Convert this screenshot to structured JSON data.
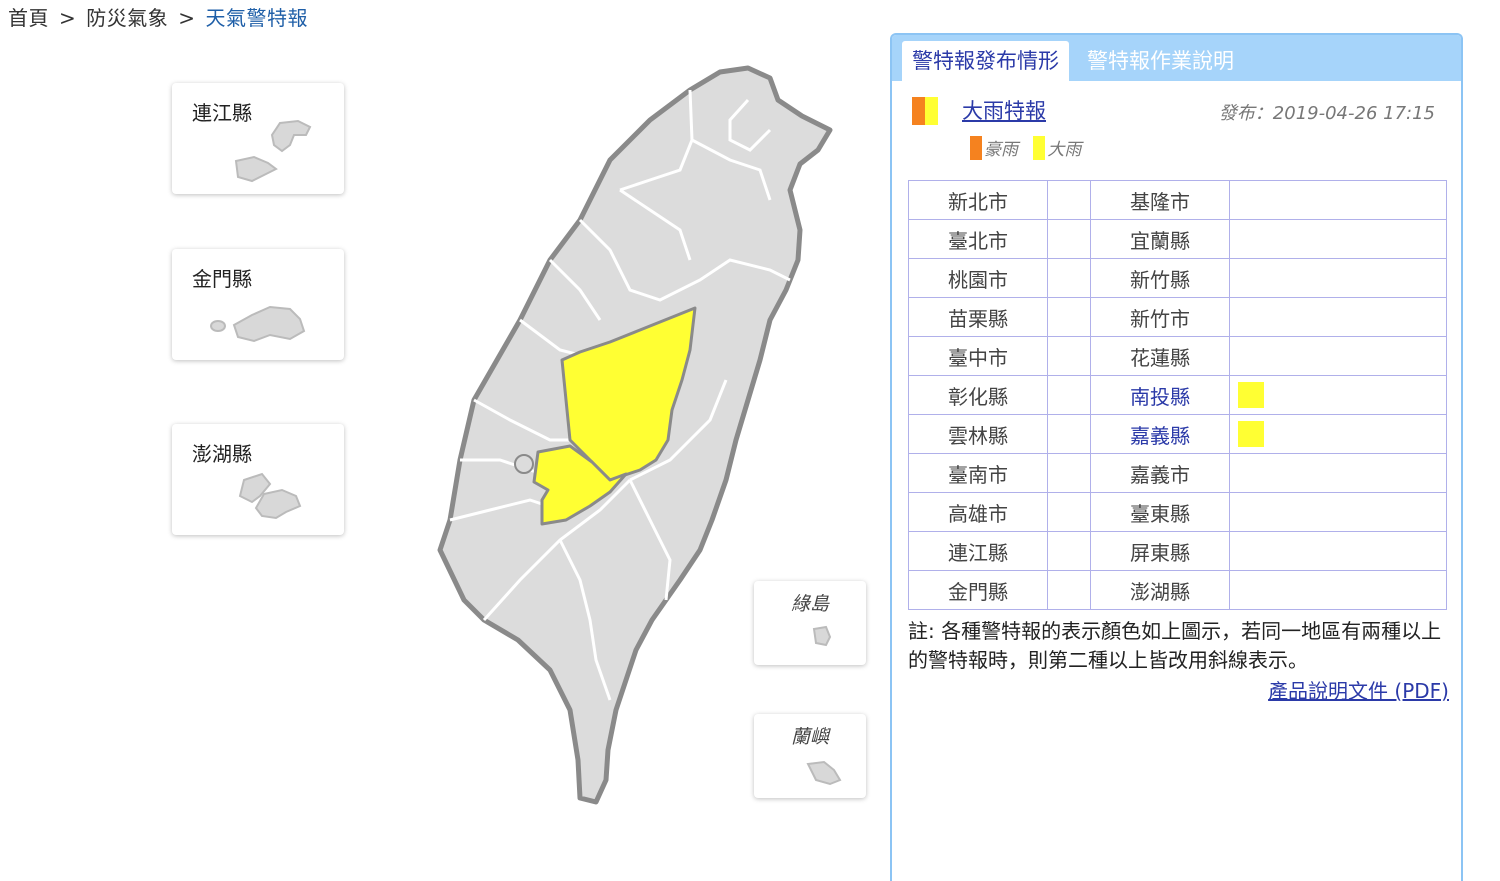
{
  "breadcrumb": {
    "home": "首頁",
    "section": "防災氣象",
    "current": "天氣警特報",
    "separator": ">"
  },
  "islands": {
    "lienchiang": "連江縣",
    "kinmen": "金門縣",
    "penghu": "澎湖縣",
    "green_island": "綠島",
    "orchid_island": "蘭嶼"
  },
  "panel": {
    "tabs": [
      "警特報發布情形",
      "警特報作業說明"
    ],
    "warning_title": "大雨特報",
    "issued": "發布：2019-04-26 17:15",
    "legend": [
      {
        "label": "豪雨",
        "color": "#f5821f"
      },
      {
        "label": "大雨",
        "color": "#ffff33"
      }
    ],
    "rows": [
      {
        "left": "新北市",
        "left_flag": "",
        "right": "基隆市",
        "right_flag": ""
      },
      {
        "left": "臺北市",
        "left_flag": "",
        "right": "宜蘭縣",
        "right_flag": ""
      },
      {
        "left": "桃園市",
        "left_flag": "",
        "right": "新竹縣",
        "right_flag": ""
      },
      {
        "left": "苗栗縣",
        "left_flag": "",
        "right": "新竹市",
        "right_flag": ""
      },
      {
        "left": "臺中市",
        "left_flag": "",
        "right": "花蓮縣",
        "right_flag": ""
      },
      {
        "left": "彰化縣",
        "left_flag": "",
        "right": "南投縣",
        "right_flag": "大雨"
      },
      {
        "left": "雲林縣",
        "left_flag": "",
        "right": "嘉義縣",
        "right_flag": "大雨"
      },
      {
        "left": "臺南市",
        "left_flag": "",
        "right": "嘉義市",
        "right_flag": ""
      },
      {
        "left": "高雄市",
        "left_flag": "",
        "right": "臺東縣",
        "right_flag": ""
      },
      {
        "left": "連江縣",
        "left_flag": "",
        "right": "屏東縣",
        "right_flag": ""
      },
      {
        "left": "金門縣",
        "left_flag": "",
        "right": "澎湖縣",
        "right_flag": ""
      }
    ],
    "note": "註: 各種警特報的表示顏色如上圖示，若同一地區有兩種以上的警特報時，則第二種以上皆改用斜線表示。",
    "pdf_link": "產品說明文件 (PDF)"
  },
  "colors": {
    "heavy_rain": "#ffff33",
    "torrential_rain": "#f5821f",
    "land": "#dcdcdc",
    "border": "#888888"
  }
}
